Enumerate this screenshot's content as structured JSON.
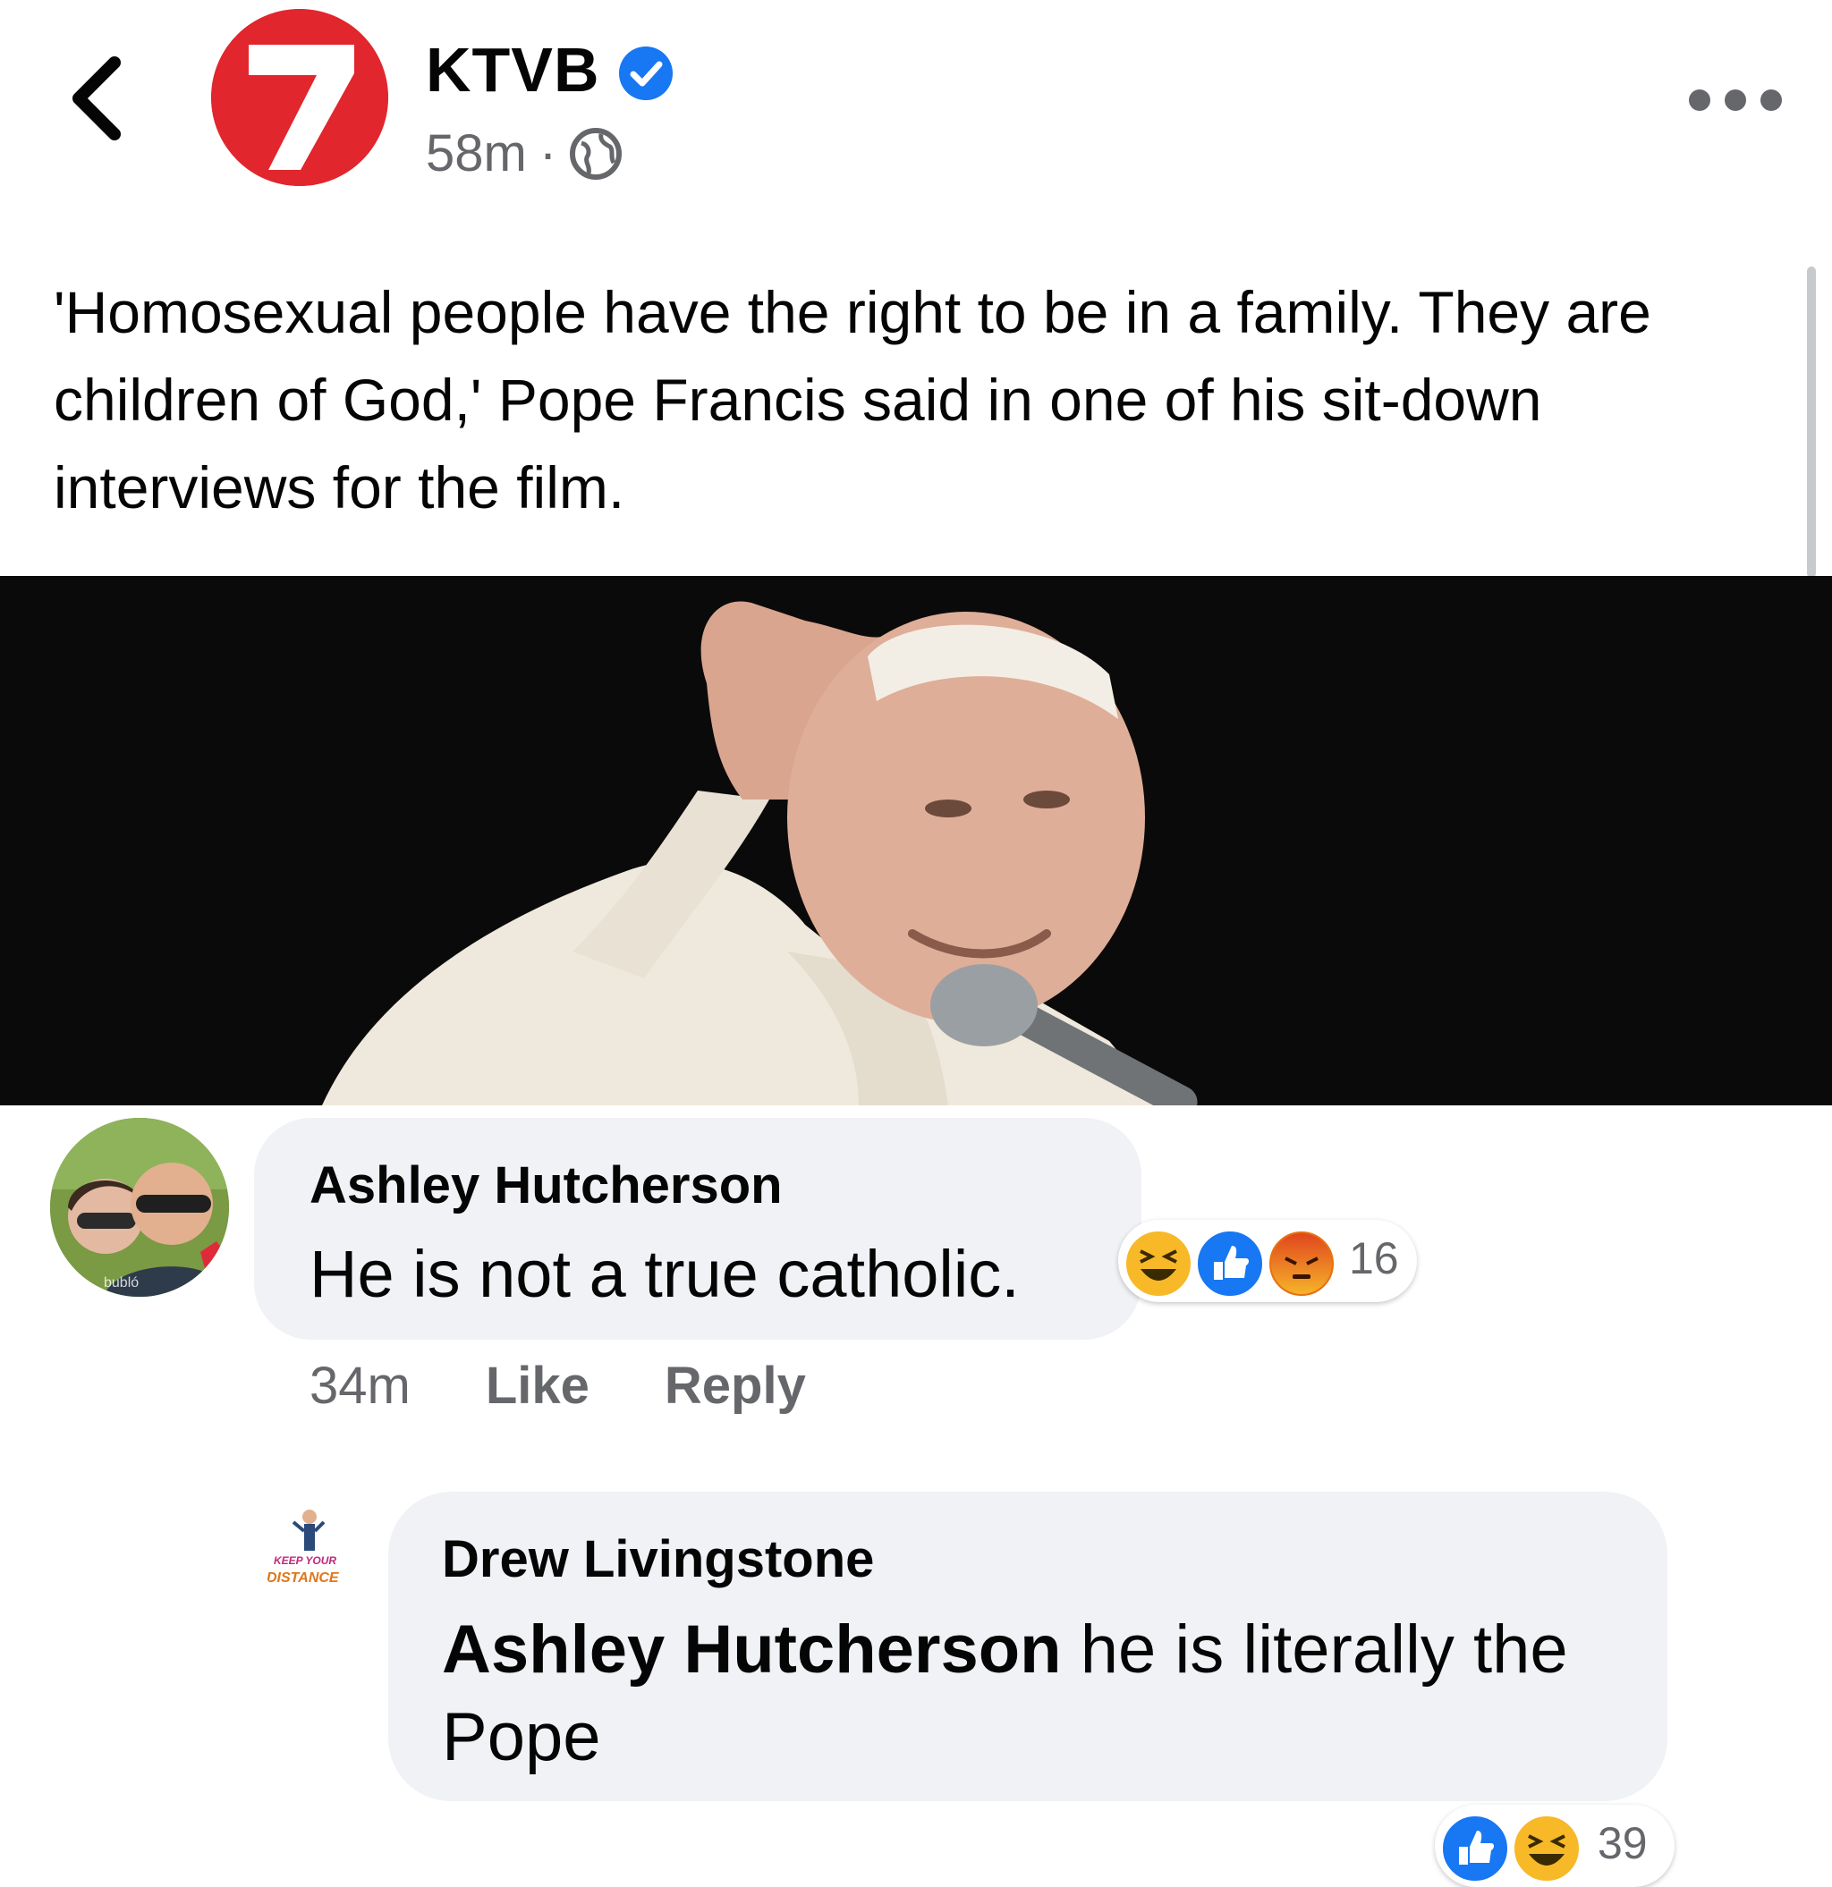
{
  "header": {
    "page_name": "KTVB",
    "avatar_glyph": "7",
    "time": "58m",
    "dot": "·",
    "icons": [
      "back-chevron-icon",
      "verified-badge-icon",
      "globe-icon",
      "more-dots-icon"
    ]
  },
  "post": {
    "text": "'Homosexual people have the right to be in a family. They are children of God,' Pope Francis said in one of his sit-down interviews for the film."
  },
  "comments": [
    {
      "author": "Ashley Hutcherson",
      "text": "He is not a true catholic.",
      "avatar_overlay_text": "bubló",
      "reaction_count": "16",
      "reactions": [
        "haha",
        "like",
        "angry"
      ],
      "time": "34m",
      "like_label": "Like",
      "reply_label": "Reply"
    },
    {
      "author": "Drew Livingstone",
      "mention": "Ashley Hutcherson",
      "text": " he is literally the Pope",
      "avatar_text_top": "KEEP YOUR",
      "avatar_text_bottom": "DISTANCE",
      "reaction_count": "39",
      "reactions": [
        "like",
        "haha"
      ]
    }
  ],
  "colors": {
    "brand_red": "#e1262d",
    "verified_blue": "#1877f2",
    "bubble_bg": "#f0f2f5",
    "meta_gray": "#65676b",
    "image_bg": "#0b0a0a"
  }
}
